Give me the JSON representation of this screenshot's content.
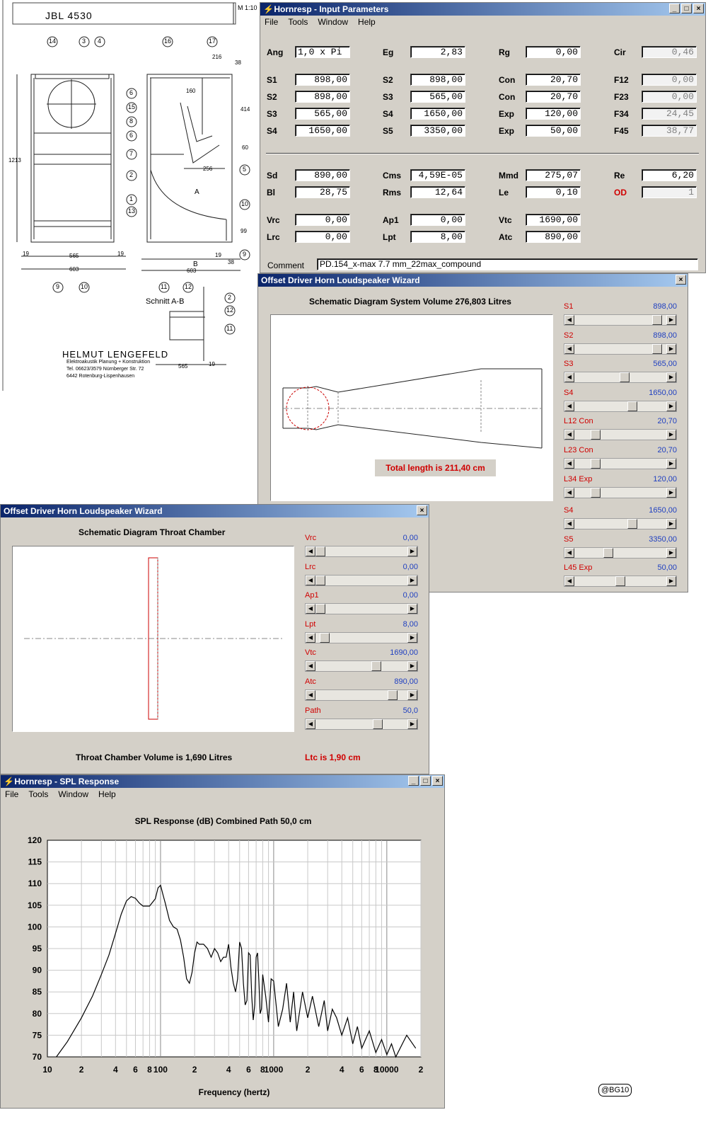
{
  "drawing": {
    "model": "JBL 4530",
    "scale": "M 1:10",
    "signature": "HELMUT LENGEFELD",
    "company_lines": [
      "Elektroakustik Planung + Konstruktion",
      "Tel. 06623/3579 Nürnberger Str. 72",
      "6442 Rotenburg-Lispenhausen"
    ],
    "section_label": "Schnitt A-B",
    "callouts": [
      "14",
      "3",
      "4",
      "16",
      "17",
      "6",
      "15",
      "8",
      "6",
      "7",
      "5",
      "2",
      "1",
      "13",
      "10",
      "9",
      "10",
      "11",
      "12",
      "2",
      "12",
      "11",
      "9"
    ],
    "dims": [
      "216",
      "38",
      "160",
      "414",
      "60",
      "256",
      "1213",
      "99",
      "19",
      "565",
      "19",
      "603",
      "603",
      "38",
      "19",
      "565",
      "19"
    ],
    "markers": [
      "A",
      "B"
    ]
  },
  "input_window": {
    "title": "Hornresp - Input Parameters",
    "menu": [
      "File",
      "Tools",
      "Window",
      "Help"
    ],
    "rows1": [
      [
        [
          "Ang",
          "1,0 x Pi"
        ],
        [
          "Eg",
          "2,83"
        ],
        [
          "Rg",
          "0,00"
        ],
        [
          "Cir",
          "0,46"
        ]
      ],
      [
        [
          "S1",
          "898,00"
        ],
        [
          "S2",
          "898,00"
        ],
        [
          "Con",
          "20,70"
        ],
        [
          "F12",
          "0,00"
        ]
      ],
      [
        [
          "S2",
          "898,00"
        ],
        [
          "S3",
          "565,00"
        ],
        [
          "Con",
          "20,70"
        ],
        [
          "F23",
          "0,00"
        ]
      ],
      [
        [
          "S3",
          "565,00"
        ],
        [
          "S4",
          "1650,00"
        ],
        [
          "Exp",
          "120,00"
        ],
        [
          "F34",
          "24,45"
        ]
      ],
      [
        [
          "S4",
          "1650,00"
        ],
        [
          "S5",
          "3350,00"
        ],
        [
          "Exp",
          "50,00"
        ],
        [
          "F45",
          "38,77"
        ]
      ]
    ],
    "rows2": [
      [
        [
          "Sd",
          "890,00"
        ],
        [
          "Cms",
          "4,59E-05"
        ],
        [
          "Mmd",
          "275,07"
        ],
        [
          "Re",
          "6,20"
        ]
      ],
      [
        [
          "Bl",
          "28,75"
        ],
        [
          "Rms",
          "12,64"
        ],
        [
          "Le",
          "0,10"
        ],
        [
          "OD",
          "1"
        ]
      ],
      [
        [
          "Vrc",
          "0,00"
        ],
        [
          "Ap1",
          "0,00"
        ],
        [
          "Vtc",
          "1690,00"
        ]
      ],
      [
        [
          "Lrc",
          "0,00"
        ],
        [
          "Lpt",
          "8,00"
        ],
        [
          "Atc",
          "890,00"
        ]
      ]
    ],
    "comment_label": "Comment",
    "comment": "PD.154_x-max 7.7 mm_22max_compound"
  },
  "wizard1": {
    "title": "Offset Driver Horn Loudspeaker Wizard",
    "heading": "Schematic Diagram   System Volume 276,803 Litres",
    "total_length": "Total length is 211,40 cm",
    "sliders": [
      {
        "label": "S1",
        "value": "898,00",
        "pos": 0.95
      },
      {
        "label": "S2",
        "value": "898,00",
        "pos": 0.95
      },
      {
        "label": "S3",
        "value": "565,00",
        "pos": 0.55
      },
      {
        "label": "S4",
        "value": "1650,00",
        "pos": 0.65
      },
      {
        "label": "L12  Con",
        "value": "20,70",
        "pos": 0.2
      },
      {
        "label": "L23  Con",
        "value": "20,70",
        "pos": 0.2
      },
      {
        "label": "L34  Exp",
        "value": "120,00",
        "pos": 0.2
      },
      {
        "label": "S4",
        "value": "1650,00",
        "pos": 0.65
      },
      {
        "label": "S5",
        "value": "3350,00",
        "pos": 0.35
      },
      {
        "label": "L45  Exp",
        "value": "50,00",
        "pos": 0.5
      }
    ]
  },
  "wizard2": {
    "title": "Offset Driver Horn Loudspeaker Wizard",
    "heading": "Schematic Diagram   Throat Chamber",
    "volume": "Throat Chamber Volume is 1,690 Litres",
    "ltc": "Ltc is 1,90 cm",
    "sliders": [
      {
        "label": "Vrc",
        "value": "0,00",
        "pos": 0.0
      },
      {
        "label": "Lrc",
        "value": "0,00",
        "pos": 0.0
      },
      {
        "label": "Ap1",
        "value": "0,00",
        "pos": 0.0
      },
      {
        "label": "Lpt",
        "value": "8,00",
        "pos": 0.05
      },
      {
        "label": "Vtc",
        "value": "1690,00",
        "pos": 0.68
      },
      {
        "label": "Atc",
        "value": "890,00",
        "pos": 0.88
      },
      {
        "label": "Path",
        "value": "50,0",
        "pos": 0.7
      }
    ]
  },
  "spl_window": {
    "title": "Hornresp - SPL Response",
    "menu": [
      "File",
      "Tools",
      "Window",
      "Help"
    ],
    "chart_title": "SPL Response (dB)   Combined   Path 50,0 cm",
    "xlabel": "Frequency (hertz)",
    "watermark": "@BG10"
  },
  "chart_data": {
    "type": "line",
    "title": "SPL Response (dB)   Combined   Path 50,0 cm",
    "xlabel": "Frequency (hertz)",
    "ylabel": "",
    "x_scale": "log",
    "xlim": [
      10,
      20000
    ],
    "ylim": [
      70,
      120
    ],
    "x_ticks": [
      "10",
      "2",
      "4",
      "6",
      "8",
      "100",
      "2",
      "4",
      "6",
      "8",
      "1000",
      "2",
      "4",
      "6",
      "8",
      "10000",
      "2"
    ],
    "y_ticks": [
      "120",
      "115",
      "110",
      "105",
      "100",
      "95",
      "90",
      "85",
      "80",
      "75",
      "70"
    ],
    "grid": true,
    "series": [
      {
        "name": "",
        "x": [
          12,
          15,
          20,
          25,
          30,
          35,
          40,
          45,
          50,
          55,
          60,
          65,
          70,
          80,
          90,
          95,
          100,
          105,
          110,
          120,
          130,
          140,
          150,
          160,
          170,
          180,
          190,
          200,
          210,
          220,
          240,
          260,
          280,
          300,
          320,
          340,
          360,
          380,
          400,
          420,
          440,
          460,
          480,
          500,
          520,
          540,
          560,
          580,
          600,
          620,
          640,
          660,
          680,
          700,
          720,
          740,
          760,
          780,
          800,
          850,
          900,
          950,
          1000,
          1100,
          1200,
          1300,
          1400,
          1500,
          1600,
          1800,
          2000,
          2200,
          2500,
          2800,
          3000,
          3300,
          3600,
          4000,
          4500,
          5000,
          5500,
          6000,
          7000,
          8000,
          9000,
          10000,
          11000,
          12000,
          15000,
          18000
        ],
        "y": [
          70,
          73.5,
          79,
          84,
          89,
          93.5,
          98.5,
          103,
          106,
          107,
          106.6,
          105.5,
          104.8,
          104.8,
          106.5,
          109,
          109.6,
          107.5,
          105.5,
          101.5,
          100,
          99.5,
          97,
          93,
          88,
          87,
          89.5,
          94,
          96.5,
          96,
          96,
          95,
          93,
          95,
          94,
          92,
          93,
          93,
          96,
          90.5,
          87,
          85,
          88,
          96.5,
          95,
          87,
          82,
          83,
          94,
          93.5,
          84,
          78.5,
          82,
          93,
          94,
          87.5,
          80,
          81,
          89,
          84,
          78,
          88,
          87.5,
          77,
          81,
          87,
          78,
          85,
          76,
          85,
          79,
          84,
          77,
          83,
          76,
          81,
          79,
          75,
          79,
          73,
          77,
          72,
          76,
          71,
          74,
          70.5,
          73,
          70,
          75,
          72
        ]
      }
    ]
  }
}
